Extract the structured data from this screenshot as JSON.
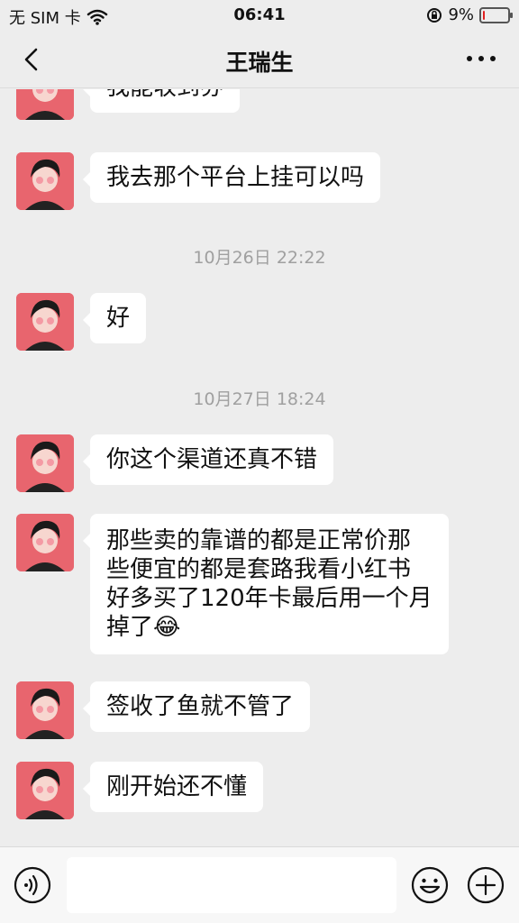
{
  "status_bar": {
    "carrier": "无 SIM 卡",
    "time": "06:41",
    "battery_percent": "9%",
    "battery_level": 0.09,
    "icons": [
      "wifi-icon",
      "rotation-lock-icon",
      "battery-icon"
    ]
  },
  "nav": {
    "title": "王瑞生",
    "back_icon": "chevron-left-icon",
    "more_icon": "more-dots-icon"
  },
  "messages": [
    {
      "type": "text",
      "text": "我能收到券"
    },
    {
      "type": "text",
      "text": "我去那个平台上挂可以吗"
    },
    {
      "type": "time",
      "text": "10月26日 22:22"
    },
    {
      "type": "text",
      "text": "好"
    },
    {
      "type": "time",
      "text": "10月27日 18:24"
    },
    {
      "type": "text",
      "text": "你这个渠道还真不错"
    },
    {
      "type": "text",
      "lines": [
        "那些卖的靠谱的都是正常价那",
        "些便宜的都是套路我看小红书",
        "好多买了120年卡最后用一个月",
        "掉了"
      ],
      "emoji": "😂"
    },
    {
      "type": "text",
      "text": "签收了鱼就不管了"
    },
    {
      "type": "text",
      "text": "刚开始还不懂"
    }
  ],
  "input_bar": {
    "voice_icon": "voice-icon",
    "emoji_icon": "emoji-icon",
    "add_icon": "plus-circle-icon",
    "input_value": ""
  },
  "colors": {
    "background": "#ededed",
    "bubble": "#ffffff",
    "avatar": "#e8656e",
    "timestamp": "#a0a0a0",
    "battery_low": "#e02020"
  }
}
